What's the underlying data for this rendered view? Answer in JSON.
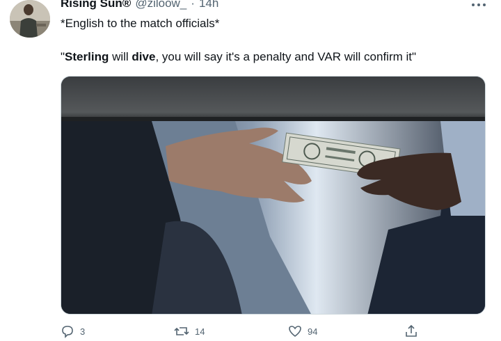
{
  "tweet": {
    "display_name": "Rising Sun®",
    "handle": "@ziloow_",
    "separator": "·",
    "time": "14h",
    "line1": "*English to the match officials*",
    "line2_parts": {
      "q1": "\"",
      "b1": "Sterling",
      "t1": " will ",
      "b2": "dive",
      "t2": ", you will say it's a penalty and VAR will confirm it\""
    },
    "media_alt": "Photo of a hand passing dollar banknotes to another hand under a table"
  },
  "actions": {
    "reply_count": "3",
    "retweet_count": "14",
    "like_count": "94"
  },
  "icons": {
    "more": "more-dots-icon",
    "reply": "reply-icon",
    "retweet": "retweet-icon",
    "like": "like-icon",
    "share": "share-icon"
  },
  "colors": {
    "text": "#0f1419",
    "secondary": "#536471",
    "border": "#cfd9de"
  }
}
